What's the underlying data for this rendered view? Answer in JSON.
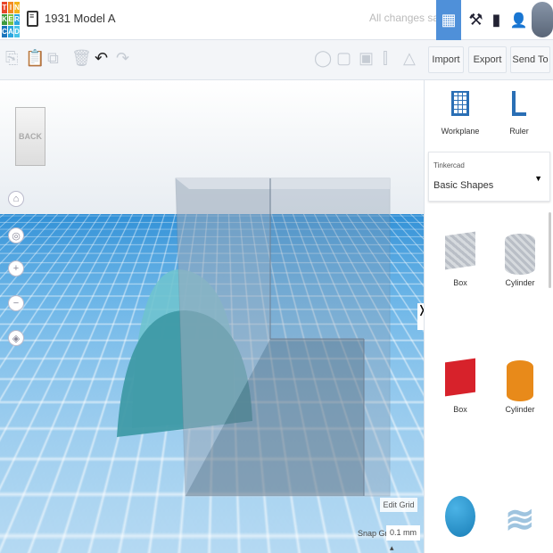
{
  "header": {
    "logo_letters": [
      "T",
      "I",
      "N",
      "K",
      "E",
      "R",
      "C",
      "A",
      "D"
    ],
    "logo_colors": [
      "#e8462b",
      "#f38b22",
      "#f3b21b",
      "#3e9a3f",
      "#7ac143",
      "#2ca6de",
      "#1b75bc",
      "#2ca6de",
      "#47c3e8"
    ],
    "title": "1931 Model A",
    "status": "All changes saved",
    "accent": "#4f90d9"
  },
  "toolbar": {
    "import": "Import",
    "export": "Export",
    "send_to": "Send To"
  },
  "viewport": {
    "back_label": "BACK",
    "edit_grid": "Edit Grid",
    "snap_grid_label": "Snap Grid",
    "snap_grid_value": "0.1 mm"
  },
  "panel": {
    "workplane": "Workplane",
    "ruler": "Ruler",
    "library_label": "Tinkercad",
    "library_value": "Basic Shapes",
    "shapes": [
      {
        "name": "Box"
      },
      {
        "name": "Cylinder"
      },
      {
        "name": "Box"
      },
      {
        "name": "Cylinder"
      }
    ]
  }
}
